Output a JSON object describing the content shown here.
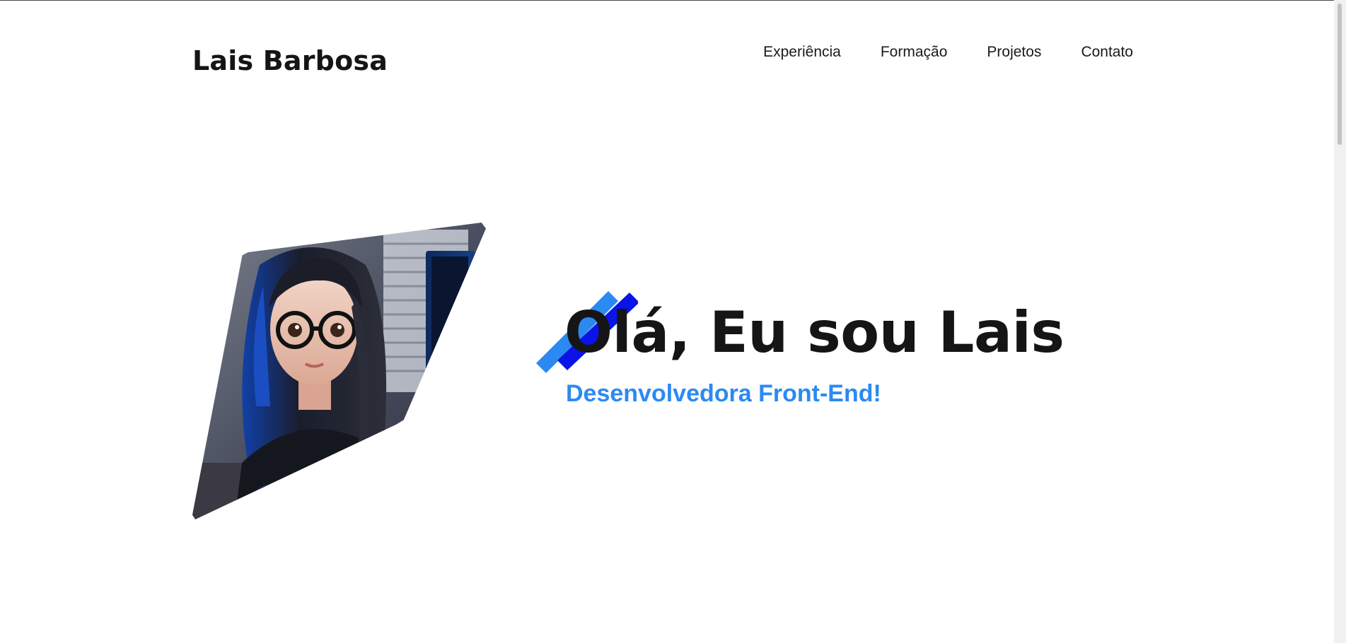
{
  "header": {
    "brand": "Lais Barbosa",
    "nav": [
      {
        "label": "Experiência"
      },
      {
        "label": "Formação"
      },
      {
        "label": "Projetos"
      },
      {
        "label": "Contato"
      }
    ]
  },
  "hero": {
    "headline": "Olá, Eu sou Lais",
    "subtitle": "Desenvolvedora Front-End!",
    "photo_alt": "avatar-illustration"
  },
  "colors": {
    "accent_blue": "#2b8af2",
    "accent_deep_blue": "#0a14e6",
    "text": "#151515"
  }
}
